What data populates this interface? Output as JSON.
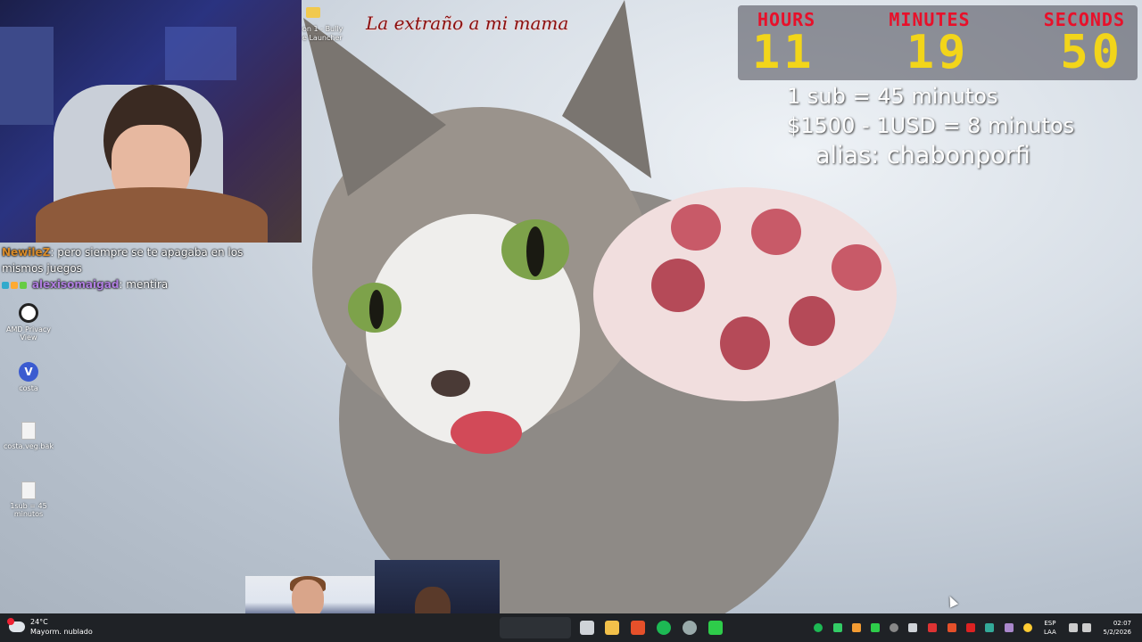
{
  "overlay": {
    "title": "La extraño a mi mama"
  },
  "timer": {
    "labels": [
      "HOURS",
      "MINUTES",
      "SECONDS"
    ],
    "hours": "11",
    "minutes": "19",
    "seconds": "50"
  },
  "rules": {
    "line1": "1 sub = 45 minutos",
    "line2": "$1500 - 1USD = 8 minutos",
    "line3": "alias: chabonporfi"
  },
  "chat": [
    {
      "user": "NewileZ",
      "text": "pero siempre se te apagaba en los mismos juegos"
    },
    {
      "user": "alexisomaigad",
      "text": "mentira"
    }
  ],
  "desktop": {
    "launcher_label": "on 1 - Bully\ne Launcher",
    "icons": [
      {
        "label": "AMD Privacy View",
        "icon": "amd-icon"
      },
      {
        "label": "costa",
        "icon": "costa-icon"
      },
      {
        "label": "costa.veg.bak",
        "icon": "file-icon"
      },
      {
        "label": "1sub = 45 minutos",
        "icon": "file-icon"
      }
    ]
  },
  "taskbar": {
    "weather_temp": "24°C",
    "weather_desc": "Mayorm. nublado",
    "lang_top": "ESP",
    "lang_bottom": "LAA",
    "time": "02:07",
    "date": "5/2/2026"
  },
  "colors": {
    "timer_label": "#e8102a",
    "timer_digits": "#f2d51a",
    "taskbar_bg": "#1f2226"
  }
}
